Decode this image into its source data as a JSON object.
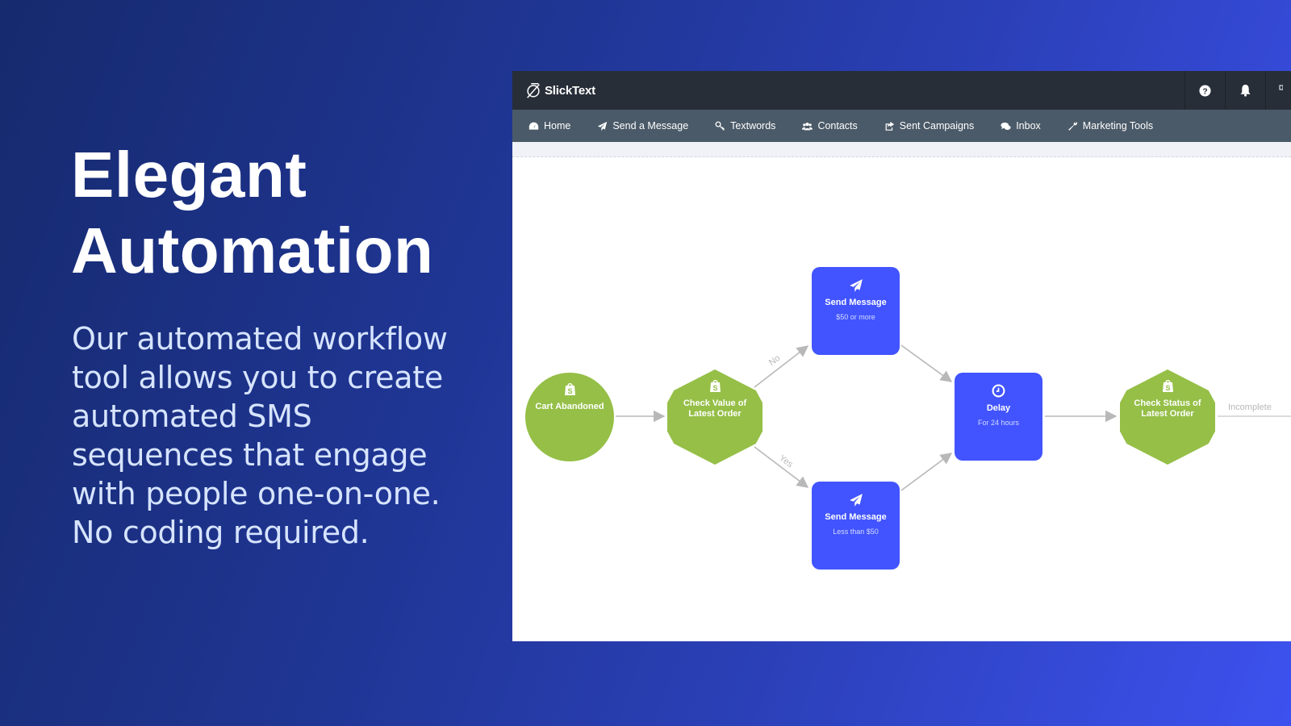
{
  "hero": {
    "title_lines": [
      "Elegant",
      "Automation"
    ],
    "body_lines": [
      "Our automated workflow",
      "tool allows you to create",
      "automated SMS",
      "sequences that engage",
      "with people one-on-one.",
      "No coding required."
    ]
  },
  "app": {
    "brand": "SlickText",
    "topbar_icons": [
      "help-icon",
      "bell-icon",
      "user-menu-icon"
    ],
    "nav": [
      {
        "label": "Home",
        "icon": "dashboard-icon"
      },
      {
        "label": "Send a Message",
        "icon": "paper-plane-icon"
      },
      {
        "label": "Textwords",
        "icon": "key-icon"
      },
      {
        "label": "Contacts",
        "icon": "users-icon"
      },
      {
        "label": "Sent Campaigns",
        "icon": "share-square-icon"
      },
      {
        "label": "Inbox",
        "icon": "comments-icon"
      },
      {
        "label": "Marketing Tools",
        "icon": "wrench-icon"
      }
    ],
    "workflow": {
      "nodes": [
        {
          "id": "cart-abandoned",
          "title": "Cart Abandoned",
          "subtitle": "",
          "shape": "circle",
          "icon": "shopify-bag-icon"
        },
        {
          "id": "check-value",
          "title": "Check Value of Latest Order",
          "subtitle": "",
          "shape": "hexagon",
          "icon": "shopify-bag-icon"
        },
        {
          "id": "send-message-high",
          "title": "Send Message",
          "subtitle": "$50 or more",
          "shape": "rounded-square",
          "icon": "paper-plane-icon"
        },
        {
          "id": "send-message-low",
          "title": "Send Message",
          "subtitle": "Less than $50",
          "shape": "rounded-square",
          "icon": "paper-plane-icon"
        },
        {
          "id": "delay",
          "title": "Delay",
          "subtitle": "For 24 hours",
          "shape": "rounded-square",
          "icon": "clock-icon"
        },
        {
          "id": "check-status",
          "title": "Check Status of Latest Order",
          "subtitle": "",
          "shape": "hexagon",
          "icon": "shopify-bag-icon"
        }
      ],
      "edge_labels": {
        "no": "No",
        "yes": "Yes",
        "incomplete": "Incomplete"
      }
    },
    "colors": {
      "topbar": "#282e38",
      "navbar": "#4b5a68",
      "shopify_green": "#95bf47",
      "action_blue": "#4154ff",
      "edge_gray": "#b8b8b8"
    }
  }
}
